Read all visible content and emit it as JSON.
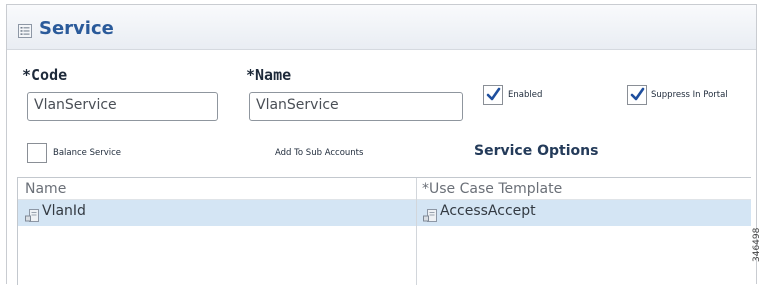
{
  "header": {
    "title": "Service",
    "icon": "list-form-icon"
  },
  "form": {
    "code": {
      "label": "*Code",
      "value": "VlanService"
    },
    "name": {
      "label": "*Name",
      "value": "VlanService"
    },
    "enabled": {
      "label": "Enabled",
      "checked": true
    },
    "suppress_in_portal": {
      "label": "Suppress In Portal",
      "checked": true
    },
    "balance_service": {
      "label": "Balance Service",
      "checked": false
    },
    "add_to_sub_accounts": {
      "label": "Add To Sub Accounts"
    }
  },
  "service_options": {
    "heading": "Service Options",
    "columns": [
      "Name",
      "*Use Case Template"
    ],
    "rows": [
      {
        "name": "VlanId",
        "template": "AccessAccept",
        "selected": true
      }
    ]
  },
  "figure_id": "346498",
  "colors": {
    "header_title": "#2a5a9a",
    "selected_row": "#d4e5f4",
    "checkmark": "#1f4f9e"
  }
}
